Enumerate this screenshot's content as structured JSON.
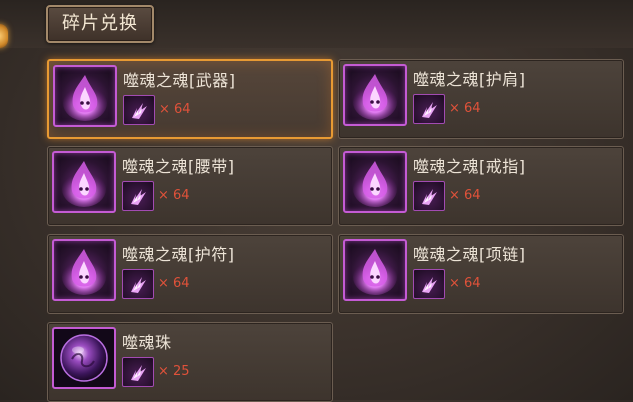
{
  "tab": {
    "label": "碎片兑换"
  },
  "items": [
    {
      "name": "噬魂之魂[武器]",
      "quantity": "× 64",
      "selected": true
    },
    {
      "name": "噬魂之魂[护肩]",
      "quantity": "× 64",
      "selected": false
    },
    {
      "name": "噬魂之魂[腰带]",
      "quantity": "× 64",
      "selected": false
    },
    {
      "name": "噬魂之魂[戒指]",
      "quantity": "× 64",
      "selected": false
    },
    {
      "name": "噬魂之魂[护符]",
      "quantity": "× 64",
      "selected": false
    },
    {
      "name": "噬魂之魂[项链]",
      "quantity": "× 64",
      "selected": false
    },
    {
      "name": "噬魂珠",
      "quantity": "× 25",
      "selected": false
    }
  ],
  "colors": {
    "accent_selected": "#e89a33",
    "quantity_text": "#e0523a",
    "rarity_border": "#c45bd4"
  },
  "icons": {
    "item_icon": "purple-soul-flame-icon",
    "material_icon": "purple-fragment-icon",
    "orb_icon": "purple-soul-orb-icon"
  }
}
